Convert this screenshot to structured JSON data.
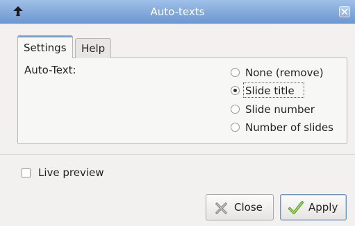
{
  "window": {
    "title": "Auto-texts"
  },
  "tabs": [
    {
      "label": "Settings",
      "active": true
    },
    {
      "label": "Help",
      "active": false
    }
  ],
  "settings": {
    "auto_text_label": "Auto-Text:",
    "options": [
      {
        "label": "None (remove)",
        "selected": false
      },
      {
        "label": "Slide title",
        "selected": true
      },
      {
        "label": "Slide number",
        "selected": false
      },
      {
        "label": "Number of slides",
        "selected": false
      }
    ]
  },
  "live_preview": {
    "label": "Live preview",
    "checked": false
  },
  "buttons": {
    "close_label": "Close",
    "apply_label": "Apply"
  },
  "colors": {
    "titlebar": "#7fa5da",
    "apply_border": "#6f93c6",
    "apply_check": "#7cc140",
    "close_x": "#8a8a8a"
  }
}
